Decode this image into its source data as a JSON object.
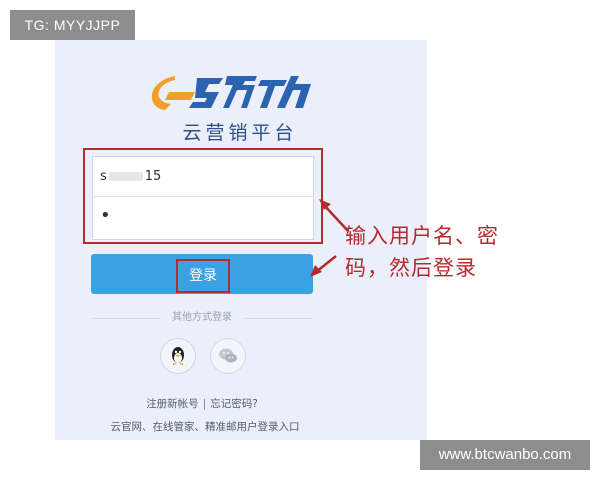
{
  "watermarks": {
    "top_left": "TG: MYYJJPP",
    "bottom_right": "www.btcwanbo.com"
  },
  "brand": {
    "logo_icon": "lingdong-logo-icon",
    "subtitle": "云营销平台"
  },
  "login_form": {
    "username_start": "s",
    "username_end": "15",
    "password_mask": "•",
    "submit_label": "登录"
  },
  "alt_login": {
    "divider_text": "其他方式登录",
    "providers": [
      {
        "icon": "qq-penguin-icon"
      },
      {
        "icon": "wechat-icon"
      }
    ]
  },
  "links": {
    "register": "注册新帐号",
    "separator": "|",
    "forgot": "忘记密码?",
    "footer": "云官网、在线管家、精准邮用户登录入口"
  },
  "annotation": {
    "line1": "输入用户名、密",
    "line2": "码，然后登录"
  },
  "colors": {
    "panel_bg": "#eaeff9",
    "button": "#3aa2e4",
    "highlight_red": "#b52a2e",
    "brand_blue": "#2c4f8c",
    "brand_orange": "#f0a02a"
  }
}
